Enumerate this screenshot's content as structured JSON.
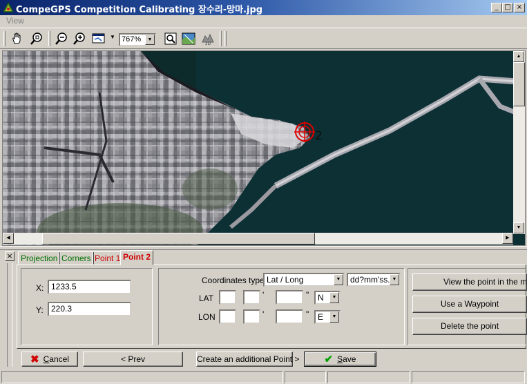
{
  "window": {
    "title": "CompeGPS Competition Calibrating 장수리-망마.jpg",
    "controls": {
      "minimize": "_",
      "maximize": "□",
      "close": "×"
    }
  },
  "menu": {
    "items": [
      "View"
    ]
  },
  "toolbar": {
    "zoom_value": "767%",
    "buttons": [
      "hand-pan-icon",
      "zoom-region-icon",
      "zoom-out-icon",
      "zoom-in-icon",
      "fit-window-icon",
      "find-icon",
      "map-layers-icon",
      "3d-view-icon"
    ]
  },
  "map": {
    "marker_label": "2",
    "colors": {
      "water": "#0d2a2c",
      "marker": "#e00000"
    }
  },
  "tabs": [
    {
      "label": "Projection",
      "color": "#007000"
    },
    {
      "label": "Corners",
      "color": "#007000"
    },
    {
      "label": "Point 1",
      "color": "#d00000"
    },
    {
      "label": "Point 2",
      "color": "#d00000",
      "active": true
    }
  ],
  "point": {
    "x_label": "X:",
    "x_value": "1233.5",
    "y_label": "Y:",
    "y_value": "220.3"
  },
  "coords": {
    "type_label": "Coordinates type:",
    "type_value": "Lat / Long",
    "format_value": "dd?mm'ss.s'",
    "lat_label": "LAT",
    "lon_label": "LON",
    "minute_mark": "'",
    "second_mark": "\"",
    "lat_hemisphere": "N",
    "lon_hemisphere": "E",
    "lat_deg": "",
    "lat_min": "",
    "lat_sec": "",
    "lon_deg": "",
    "lon_min": "",
    "lon_sec": ""
  },
  "actions": {
    "view_point": "View the point in the map",
    "use_waypoint": "Use a Waypoint",
    "delete_point": "Delete the point"
  },
  "footer": {
    "cancel_first": "C",
    "cancel_rest": "ancel",
    "prev": "< Prev",
    "create_point": "Create an additional Point >",
    "save_first": "S",
    "save_rest": "ave"
  }
}
